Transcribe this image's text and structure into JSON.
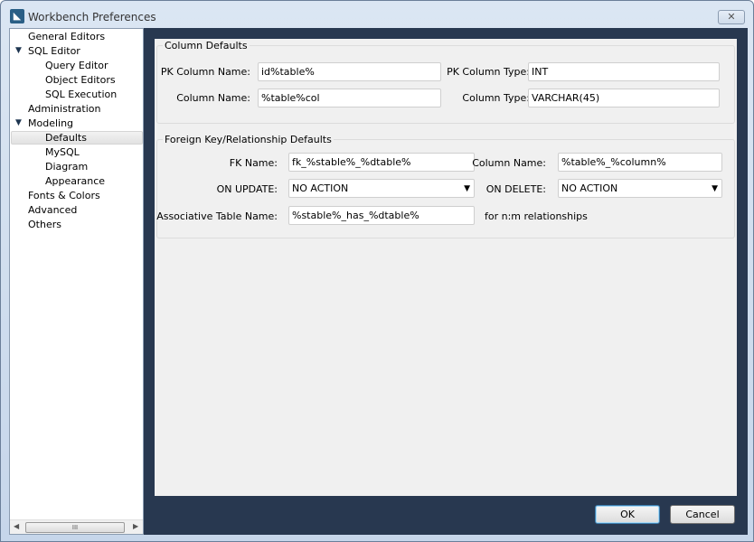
{
  "window": {
    "title": "Workbench Preferences"
  },
  "sidebar": {
    "items": [
      {
        "label": "General Editors",
        "level": 0
      },
      {
        "label": "SQL Editor",
        "level": 0,
        "expanded": true
      },
      {
        "label": "Query Editor",
        "level": 1
      },
      {
        "label": "Object Editors",
        "level": 1
      },
      {
        "label": "SQL Execution",
        "level": 1
      },
      {
        "label": "Administration",
        "level": 0
      },
      {
        "label": "Modeling",
        "level": 0,
        "expanded": true
      },
      {
        "label": "Defaults",
        "level": 1,
        "selected": true
      },
      {
        "label": "MySQL",
        "level": 1
      },
      {
        "label": "Diagram",
        "level": 1
      },
      {
        "label": "Appearance",
        "level": 1
      },
      {
        "label": "Fonts & Colors",
        "level": 0
      },
      {
        "label": "Advanced",
        "level": 0
      },
      {
        "label": "Others",
        "level": 0
      }
    ],
    "scroll_thumb": "III"
  },
  "column_defaults": {
    "title": "Column Defaults",
    "pk_name_label": "PK Column Name:",
    "pk_name": "id%table%",
    "pk_type_label": "PK Column Type:",
    "pk_type": "INT",
    "col_name_label": "Column Name:",
    "col_name": "%table%col",
    "col_type_label": "Column Type:",
    "col_type": "VARCHAR(45)"
  },
  "fk_defaults": {
    "title": "Foreign Key/Relationship Defaults",
    "fk_name_label": "FK Name:",
    "fk_name": "fk_%stable%_%dtable%",
    "col_name_label": "Column Name:",
    "col_name": "%table%_%column%",
    "on_update_label": "ON UPDATE:",
    "on_update": "NO ACTION",
    "on_delete_label": "ON DELETE:",
    "on_delete": "NO ACTION",
    "assoc_label": "Associative Table Name:",
    "assoc": "%stable%_has_%dtable%",
    "assoc_note": "for n:m relationships"
  },
  "buttons": {
    "ok": "OK",
    "cancel": "Cancel"
  }
}
